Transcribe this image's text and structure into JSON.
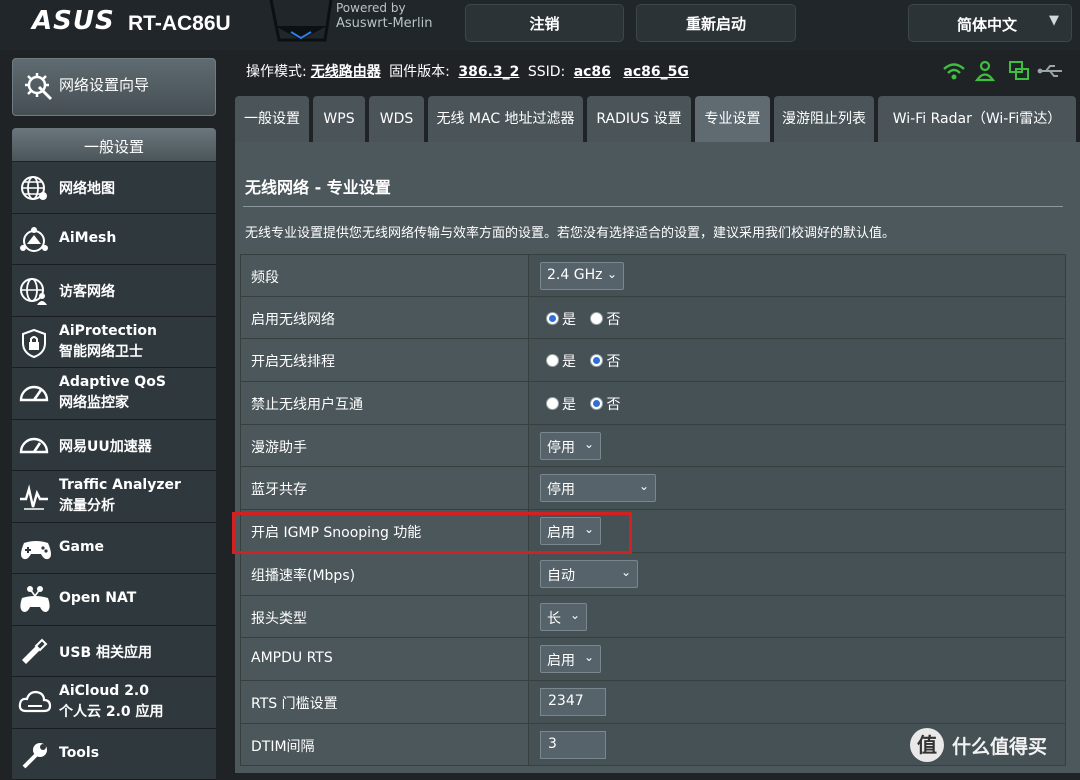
{
  "header": {
    "brand": "ASUS",
    "model": "RT-AC86U",
    "powered_line1": "Powered by",
    "powered_line2": "Asuswrt-Merlin",
    "logout_label": "注销",
    "reboot_label": "重新启动",
    "language_label": "简体中文",
    "language_chevron": "▼"
  },
  "sidebar": {
    "qis_label": "网络设置向导",
    "section_label": "一般设置",
    "items": [
      {
        "line1": "网络地图",
        "line2": "",
        "icon": "globe-network-icon"
      },
      {
        "line1": "AiMesh",
        "line2": "",
        "icon": "mesh-icon"
      },
      {
        "line1": "访客网络",
        "line2": "",
        "icon": "guest-network-icon"
      },
      {
        "line1": "AiProtection",
        "line2": "智能网络卫士",
        "icon": "shield-lock-icon"
      },
      {
        "line1": "Adaptive QoS",
        "line2": "网络监控家",
        "icon": "speedometer-icon"
      },
      {
        "line1": "网易UU加速器",
        "line2": "",
        "icon": "gauge-icon"
      },
      {
        "line1": "Traffic Analyzer",
        "line2": "流量分析",
        "icon": "traffic-wave-icon"
      },
      {
        "line1": "Game",
        "line2": "",
        "icon": "gamepad-icon"
      },
      {
        "line1": "Open NAT",
        "line2": "",
        "icon": "open-nat-gamepad-icon"
      },
      {
        "line1": "USB 相关应用",
        "line2": "",
        "icon": "usb-icon"
      },
      {
        "line1": "AiCloud 2.0",
        "line2": "个人云 2.0 应用",
        "icon": "cloud-icon"
      },
      {
        "line1": "Tools",
        "line2": "",
        "icon": "wrench-icon"
      }
    ]
  },
  "infobar": {
    "mode_label": "操作模式:",
    "mode_value": "无线路由器",
    "fw_label": "固件版本:",
    "fw_value": "386.3_2",
    "ssid_label": "SSID:",
    "ssid_24": "ac86",
    "ssid_5": "ac86_5G"
  },
  "tabs": [
    {
      "label": "一般设置",
      "active": false
    },
    {
      "label": "WPS",
      "active": false
    },
    {
      "label": "WDS",
      "active": false
    },
    {
      "label": "无线 MAC 地址过滤器",
      "active": false
    },
    {
      "label": "RADIUS 设置",
      "active": false
    },
    {
      "label": "专业设置",
      "active": true
    },
    {
      "label": "漫游阻止列表",
      "active": false
    },
    {
      "label": "Wi-Fi Radar（Wi-Fi雷达）",
      "active": false
    }
  ],
  "panel": {
    "title": "无线网络 - 专业设置",
    "description": "无线专业设置提供您无线网络传输与效率方面的设置。若您没有选择适合的设置，建议采用我们校调好的默认值。"
  },
  "settings": [
    {
      "label": "频段",
      "type": "select",
      "value": "2.4 GHz"
    },
    {
      "label": "启用无线网络",
      "type": "radio",
      "yes": "是",
      "no": "否",
      "selected": "yes"
    },
    {
      "label": "开启无线排程",
      "type": "radio",
      "yes": "是",
      "no": "否",
      "selected": "no"
    },
    {
      "label": "禁止无线用户互通",
      "type": "radio",
      "yes": "是",
      "no": "否",
      "selected": "no"
    },
    {
      "label": "漫游助手",
      "type": "select",
      "value": "停用"
    },
    {
      "label": "蓝牙共存",
      "type": "select",
      "value": "停用"
    },
    {
      "label": "开启 IGMP Snooping 功能",
      "type": "select",
      "value": "启用"
    },
    {
      "label": "组播速率(Mbps)",
      "type": "select",
      "value": "自动"
    },
    {
      "label": "报头类型",
      "type": "select",
      "value": "长"
    },
    {
      "label": "AMPDU RTS",
      "type": "select",
      "value": "启用"
    },
    {
      "label": "RTS 门槛设置",
      "type": "input",
      "value": "2347"
    },
    {
      "label": "DTIM间隔",
      "type": "input",
      "value": "3"
    }
  ],
  "select_arrow": "⌄",
  "colors": {
    "background": "#1f2326",
    "panel": "#4d585d",
    "highlight": "#d32020",
    "radio_selected": "#2f6fd6",
    "status_green": "#3fbf3f"
  },
  "watermark": {
    "symbol": "值",
    "text": "什么值得买"
  }
}
